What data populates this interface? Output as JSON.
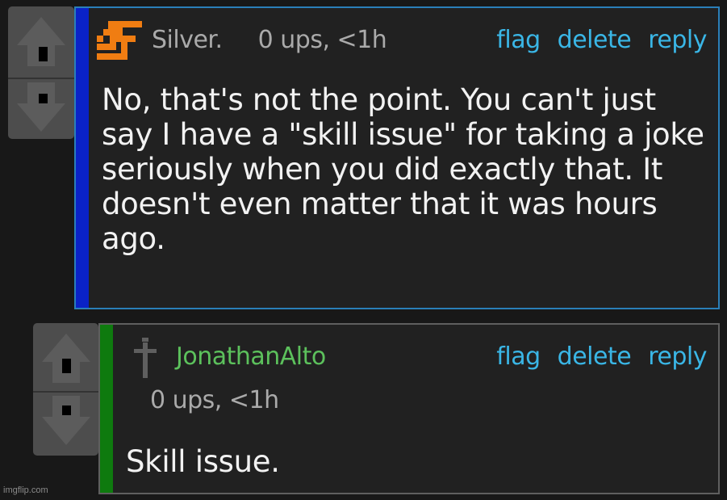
{
  "comments": [
    {
      "username": "Silver.",
      "score": "0 ups, <1h",
      "actions": {
        "flag": "flag",
        "delete": "delete",
        "reply": "reply"
      },
      "body": "No, that's not the point. You can't just say I have a \"skill issue\" for taking a joke seriously when you did exactly that. It doesn't even matter that it was hours ago.",
      "username_color": "#aaaaaa",
      "bar_color": "#0a22c7",
      "avatar": "orange-s-logo-icon"
    },
    {
      "username": "JonathanAlto",
      "score": "0 ups, <1h",
      "actions": {
        "flag": "flag",
        "delete": "delete",
        "reply": "reply"
      },
      "body": "Skill issue.",
      "username_color": "#5cc15c",
      "bar_color": "#0e7a0e",
      "avatar": "grey-cross-icon"
    }
  ],
  "watermark": "imgflip.com",
  "colors": {
    "link": "#3ab6e6",
    "background": "#181818",
    "panel": "#212121"
  }
}
